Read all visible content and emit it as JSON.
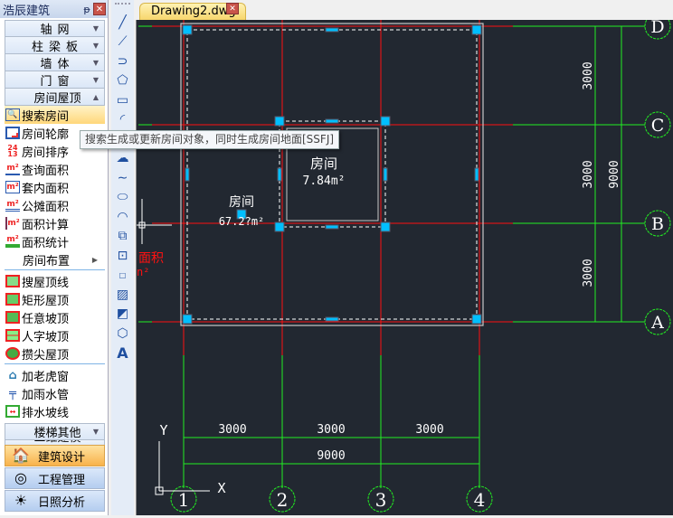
{
  "sidebar": {
    "title": "浩辰建筑",
    "pin": "ᵽ",
    "close": "✕",
    "categories": [
      {
        "label": "轴网"
      },
      {
        "label": "柱梁板"
      },
      {
        "label": "墙体"
      },
      {
        "label": "门窗"
      },
      {
        "label": "房间屋顶"
      }
    ],
    "items": [
      {
        "label": "搜索房间",
        "icon": "search-room"
      },
      {
        "label": "房间轮廓",
        "icon": "room-outline"
      },
      {
        "label": "房间排序",
        "icon": "room-sort"
      },
      {
        "label": "查询面积",
        "icon": "area-query"
      },
      {
        "label": "套内面积",
        "icon": "inner-area"
      },
      {
        "label": "公摊面积",
        "icon": "shared-area"
      },
      {
        "label": "面积计算",
        "icon": "area-calc"
      },
      {
        "label": "面积统计",
        "icon": "area-stats"
      }
    ],
    "submenu": "房间布置",
    "roof_items": [
      {
        "label": "搜屋顶线"
      },
      {
        "label": "矩形屋顶"
      },
      {
        "label": "任意坡顶"
      },
      {
        "label": "人字坡顶"
      },
      {
        "label": "攒尖屋顶"
      }
    ],
    "misc_items": [
      {
        "label": "加老虎窗"
      },
      {
        "label": "加雨水管"
      },
      {
        "label": "排水坡线"
      }
    ],
    "stairs_category": "楼梯其他",
    "hidden_category": "三维建模",
    "modules": [
      {
        "label": "建筑设计",
        "active": true
      },
      {
        "label": "工程管理"
      },
      {
        "label": "日照分析"
      }
    ]
  },
  "tooltip": "搜索生成或更新房间对象，同时生成房间地面[SSFJ]",
  "tab": {
    "label": "Drawing2.dwg",
    "close": "✕"
  },
  "drawing": {
    "axes_x": [
      "1",
      "2",
      "3",
      "4"
    ],
    "axes_y": [
      "A",
      "B",
      "C",
      "D"
    ],
    "dim_x": [
      "3000",
      "3000",
      "3000"
    ],
    "dim_x_total": "9000",
    "dim_y": [
      "3000",
      "3000",
      "3000"
    ],
    "dim_y_total": "9000",
    "room_name": "房间",
    "room_area": "7.84m²",
    "big_room_name": "房间",
    "big_room_area": "67.2?m²",
    "partial_red_text": "面积",
    "partial_red_unit": "n²",
    "ucs_x": "X",
    "ucs_y": "Y",
    "colors": {
      "background": "#222831",
      "axis": "#ff1a1a",
      "dimension": "#22ee22",
      "grip": "#00bfff",
      "wall": "#c8c8c8"
    }
  }
}
